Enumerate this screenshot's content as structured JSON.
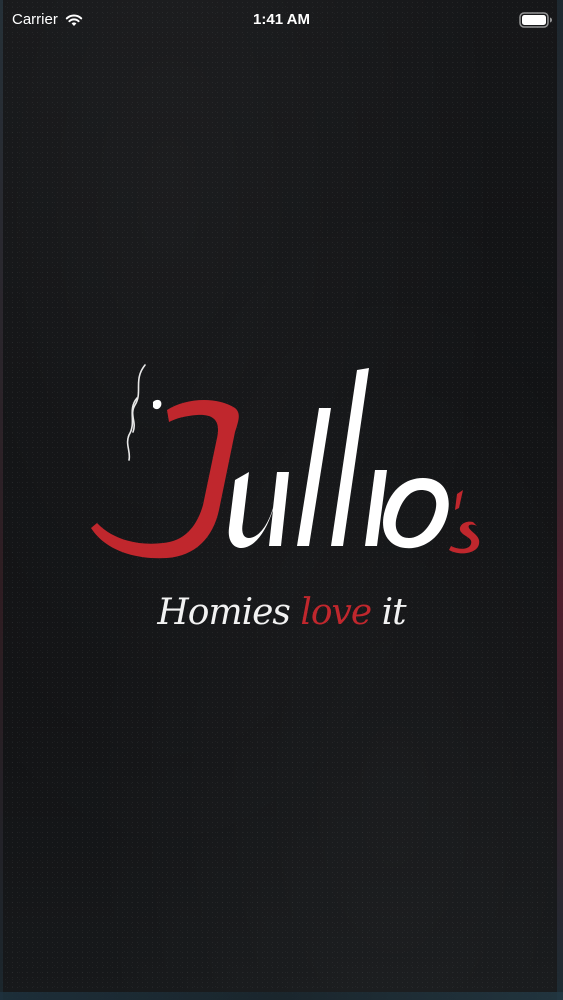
{
  "status_bar": {
    "carrier": "Carrier",
    "time": "1:41 AM",
    "wifi_icon": "wifi-icon",
    "battery_icon": "battery-full-icon"
  },
  "splash": {
    "logo": {
      "text": "Julio's",
      "icon": "steam-icon"
    },
    "tagline": {
      "part1": "Homies",
      "accent": "love",
      "part2": "it"
    }
  },
  "colors": {
    "background": "#121315",
    "brand_red": "#c0272d",
    "text_white": "#f2f2f2"
  }
}
